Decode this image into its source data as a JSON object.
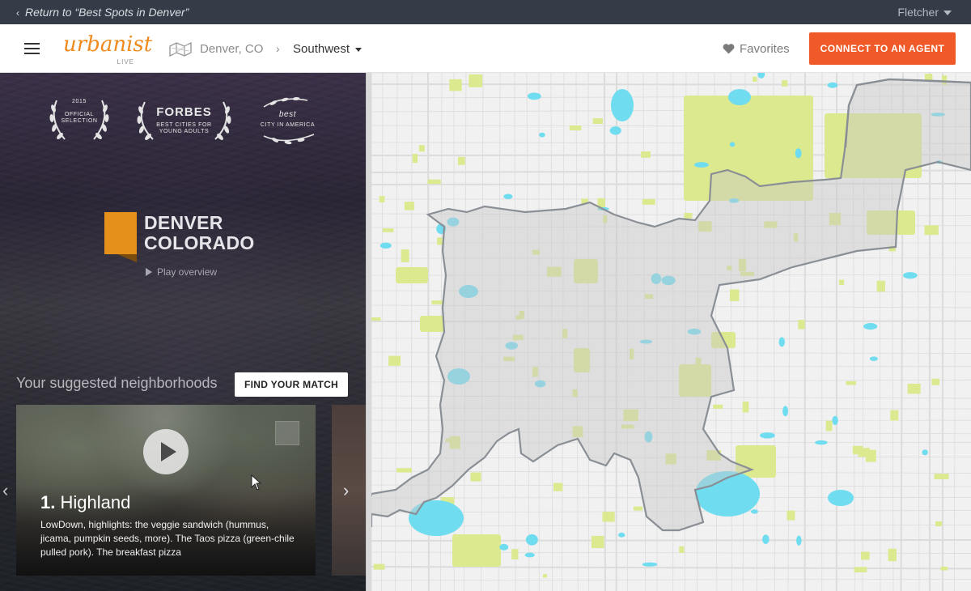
{
  "topbar": {
    "return_text": "Return to “Best Spots in Denver”",
    "user_name": "Fletcher"
  },
  "navbar": {
    "logo_word": "urbanist",
    "logo_sub": "LIVE",
    "city": "Denver, CO",
    "crumb_separator": "›",
    "region": "Southwest",
    "favorites": "Favorites",
    "cta": "CONNECT TO AN AGENT"
  },
  "awards": [
    {
      "top": "2015",
      "main": "OFFICIAL\nSELECTION"
    },
    {
      "main": "FORBES",
      "sub": "BEST CITIES FOR\nYOUNG ADULTS"
    },
    {
      "top": "best",
      "main": "CITY IN AMERICA"
    }
  ],
  "hero": {
    "city_line1": "DENVER",
    "city_line2": "COLORADO",
    "play": "Play overview"
  },
  "suggestions": {
    "title": "Your suggested neighborhoods",
    "match_button": "FIND YOUR MATCH",
    "card": {
      "number": "1.",
      "name": "Highland",
      "description": "LowDown, highlights: the veggie sandwich (hummus, jicama, pumpkin seeds, more). The Taos pizza (green-chile pulled pork). The breakfast pizza"
    }
  },
  "colors": {
    "accent": "#f05a28",
    "logo": "#ee8a1e",
    "flag": "#e5901b",
    "park": "#dce98f",
    "water": "#6fdcf0"
  }
}
